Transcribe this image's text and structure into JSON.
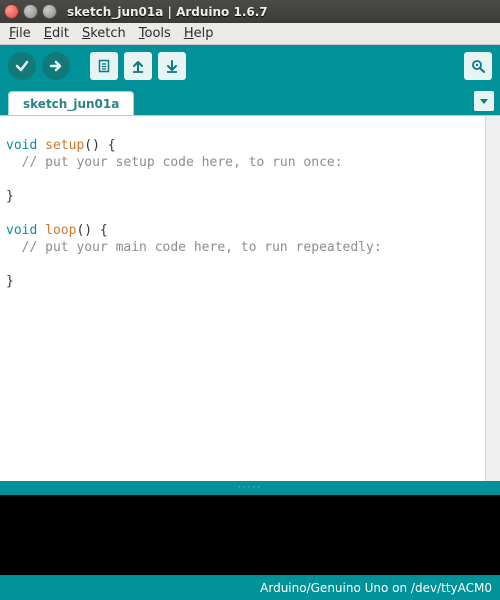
{
  "window": {
    "title": "sketch_jun01a | Arduino 1.6.7"
  },
  "menu": {
    "file": "File",
    "edit": "Edit",
    "sketch": "Sketch",
    "tools": "Tools",
    "help": "Help"
  },
  "icons": {
    "verify": "verify-icon",
    "upload": "upload-icon",
    "new": "new-icon",
    "open": "open-icon",
    "save": "save-icon",
    "serial": "serial-monitor-icon",
    "tabmenu": "tab-menu-icon"
  },
  "tab": {
    "name": "sketch_jun01a"
  },
  "code": {
    "line1_kw": "void",
    "line1_fn": "setup",
    "line1_rest": "() {",
    "line2": "  // put your setup code here, to run once:",
    "line3": "",
    "line4": "}",
    "line5": "",
    "line6_kw": "void",
    "line6_fn": "loop",
    "line6_rest": "() {",
    "line7": "  // put your main code here, to run repeatedly:",
    "line8": "",
    "line9": "}"
  },
  "status": {
    "text": "Arduino/Genuino Uno on /dev/ttyACM0"
  },
  "colors": {
    "teal": "#009298"
  }
}
